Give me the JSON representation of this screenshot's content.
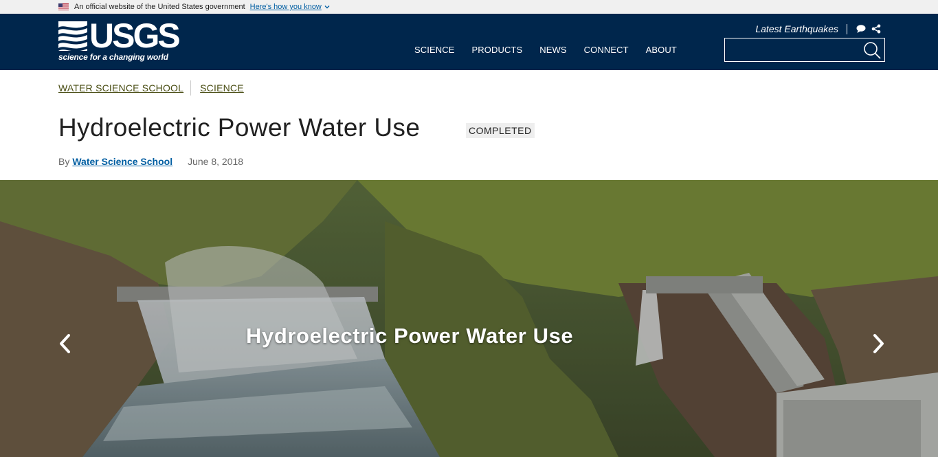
{
  "gov_banner": {
    "text": "An official website of the United States government",
    "link": "Here's how you know"
  },
  "header": {
    "logo_text": "USGS",
    "logo_tagline": "science for a changing world",
    "nav": [
      "SCIENCE",
      "PRODUCTS",
      "NEWS",
      "CONNECT",
      "ABOUT"
    ],
    "utility_link": "Latest Earthquakes",
    "icons": [
      "chat-icon",
      "share-icon"
    ],
    "search": {
      "value": "",
      "icon": "search-icon"
    }
  },
  "breadcrumbs": [
    "WATER SCIENCE SCHOOL",
    "SCIENCE"
  ],
  "page": {
    "title": "Hydroelectric Power Water Use",
    "status": "COMPLETED",
    "by_label": "By",
    "author": "Water Science School",
    "date": "June 8, 2018"
  },
  "hero": {
    "caption": "Hydroelectric Power Water Use",
    "prev_icon": "chevron-left-icon",
    "next_icon": "chevron-right-icon"
  },
  "colors": {
    "header_bg": "#00264c",
    "gov_banner_bg": "#f0f0f0",
    "breadcrumb_link": "#4a4e14",
    "author_link": "#005ea2",
    "badge_bg": "#eeeeee"
  }
}
